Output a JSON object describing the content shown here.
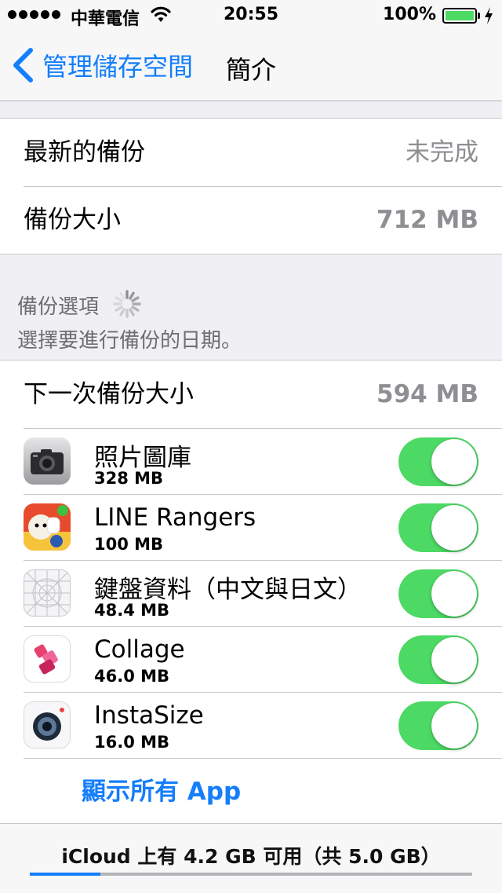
{
  "status_bar": {
    "carrier": "中華電信",
    "time": "20:55",
    "battery_percent": "100%",
    "battery_level": 1.0
  },
  "nav": {
    "back_label": "管理儲存空間",
    "title": "簡介"
  },
  "info": {
    "latest_backup_label": "最新的備份",
    "latest_backup_value": "未完成",
    "backup_size_label": "備份大小",
    "backup_size_value": "712 MB"
  },
  "backup_options": {
    "header": "備份選項",
    "subheader": "選擇要進行備份的日期。",
    "next_backup_label": "下一次備份大小",
    "next_backup_value": "594 MB"
  },
  "apps": [
    {
      "name": "照片圖庫",
      "size": "328 MB",
      "icon": "camera-icon",
      "enabled": true
    },
    {
      "name": "LINE Rangers",
      "size": "100 MB",
      "icon": "line-rangers-icon",
      "enabled": true
    },
    {
      "name": "鍵盤資料（中文與日文）",
      "size": "48.4 MB",
      "icon": "keyboard-data-icon",
      "enabled": true
    },
    {
      "name": "Collage",
      "size": "46.0 MB",
      "icon": "collage-icon",
      "enabled": true
    },
    {
      "name": "InstaSize",
      "size": "16.0 MB",
      "icon": "instasize-icon",
      "enabled": true
    }
  ],
  "show_all_label": "顯示所有 App",
  "footer": {
    "storage_text": "iCloud 上有 4.2 GB 可用（共 5.0 GB）",
    "storage_used_fraction": 0.16
  },
  "colors": {
    "accent": "#147efb",
    "toggle_on": "#4cd964"
  }
}
